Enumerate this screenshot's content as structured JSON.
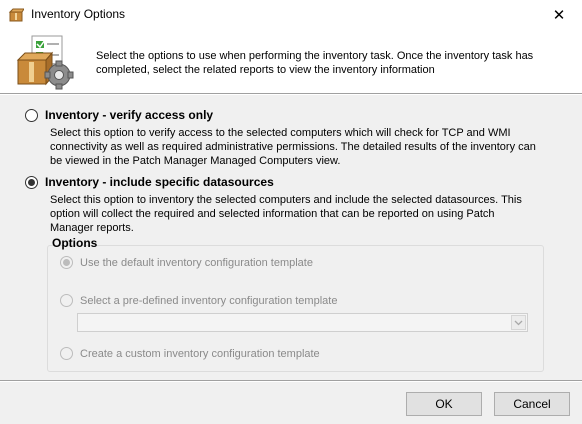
{
  "window": {
    "title": "Inventory Options",
    "close_glyph": "✕"
  },
  "header": {
    "text": "Select the options to use when performing the inventory task. Once the inventory task has completed, select the related reports to view the inventory information"
  },
  "options": {
    "verify": {
      "label": "Inventory - verify access only",
      "checked": false,
      "description": "Select this option to verify access to the selected computers which will check for TCP and WMI connectivity as well as required administrative permissions. The detailed results of the inventory can be viewed in the Patch Manager Managed Computers view."
    },
    "include": {
      "label": "Inventory - include specific datasources",
      "checked": true,
      "description": "Select this option to inventory the selected computers and include the selected datasources. This option will collect the required and selected information that can be reported on using Patch Manager reports."
    }
  },
  "group": {
    "title": "Options",
    "default_template": {
      "label": "Use the default inventory configuration template",
      "checked": true,
      "enabled": false
    },
    "predefined_template": {
      "label": "Select a pre-defined inventory configuration template",
      "checked": false,
      "enabled": false,
      "selected_value": ""
    },
    "custom_template": {
      "label": "Create a custom inventory configuration template",
      "checked": false,
      "enabled": false
    }
  },
  "buttons": {
    "ok": "OK",
    "cancel": "Cancel"
  },
  "icons": {
    "app": "inventory-box-icon",
    "header": "inventory-checklist-gear-icon",
    "dropdown": "chevron-down-icon"
  }
}
